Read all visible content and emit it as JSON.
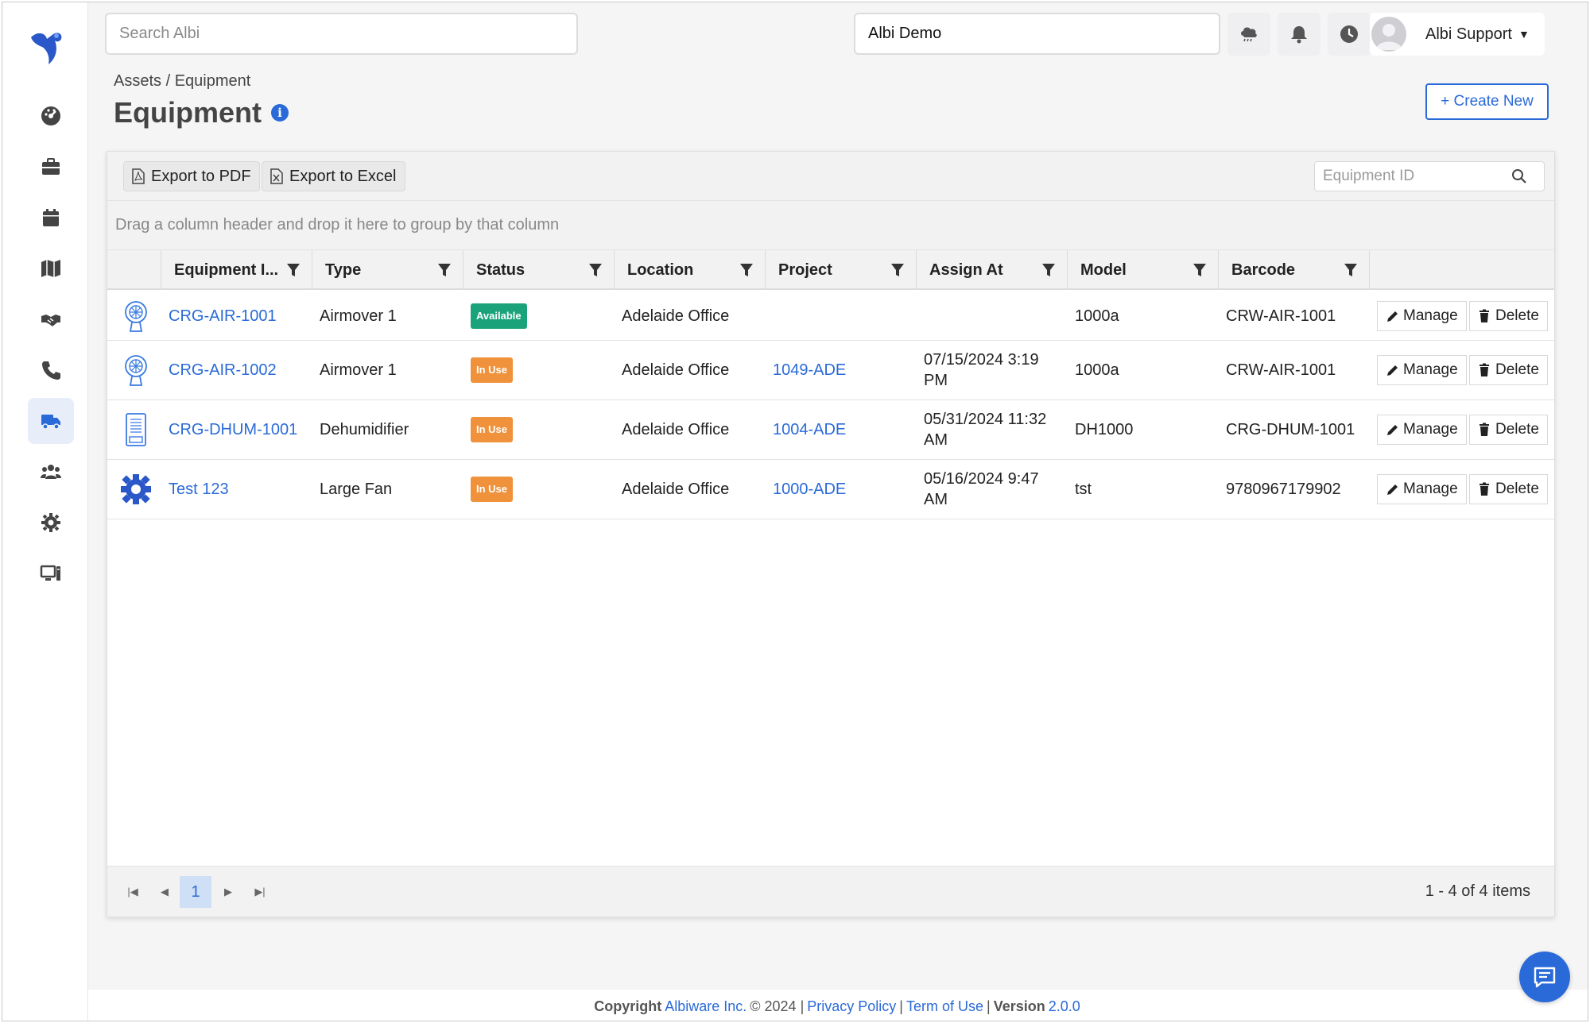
{
  "topbar": {
    "search_placeholder": "Search Albi",
    "tenant": "Albi Demo",
    "user_name": "Albi Support"
  },
  "header": {
    "breadcrumb": "Assets / Equipment",
    "title": "Equipment",
    "info_glyph": "i",
    "create_label": "+ Create New"
  },
  "toolbar": {
    "export_pdf": "Export to PDF",
    "export_excel": "Export to Excel",
    "id_search_placeholder": "Equipment ID",
    "group_hint": "Drag a column header and drop it here to group by that column"
  },
  "columns": {
    "equipment_id": "Equipment I...",
    "type": "Type",
    "status": "Status",
    "location": "Location",
    "project": "Project",
    "assign_at": "Assign At",
    "model": "Model",
    "barcode": "Barcode"
  },
  "actions": {
    "manage": "Manage",
    "delete": "Delete"
  },
  "rows": [
    {
      "icon": "airmover-icon",
      "id": "CRG-AIR-1001",
      "type": "Airmover 1",
      "status": "Available",
      "status_kind": "available",
      "location": "Adelaide Office",
      "project": "",
      "assign_at_1": "",
      "assign_at_2": "",
      "model": "1000a",
      "barcode": "CRW-AIR-1001"
    },
    {
      "icon": "airmover-icon",
      "id": "CRG-AIR-1002",
      "type": "Airmover 1",
      "status": "In Use",
      "status_kind": "inuse",
      "location": "Adelaide Office",
      "project": "1049-ADE",
      "assign_at_1": "07/15/2024 3:19",
      "assign_at_2": "PM",
      "model": "1000a",
      "barcode": "CRW-AIR-1001"
    },
    {
      "icon": "dehumidifier-icon",
      "id": "CRG-DHUM-1001",
      "type": "Dehumidifier",
      "status": "In Use",
      "status_kind": "inuse",
      "location": "Adelaide Office",
      "project": "1004-ADE",
      "assign_at_1": "05/31/2024 11:32",
      "assign_at_2": "AM",
      "model": "DH1000",
      "barcode": "CRG-DHUM-1001"
    },
    {
      "icon": "gear-icon",
      "id": "Test 123",
      "type": "Large Fan",
      "status": "In Use",
      "status_kind": "inuse",
      "location": "Adelaide Office",
      "project": "1000-ADE",
      "assign_at_1": "05/16/2024 9:47",
      "assign_at_2": "AM",
      "model": "tst",
      "barcode": "9780967179902"
    }
  ],
  "pager": {
    "current_page": "1",
    "summary": "1 - 4 of 4 items"
  },
  "footer": {
    "copyright_label": "Copyright",
    "company": "Albiware Inc.",
    "year_text": "© 2024 |",
    "privacy": "Privacy Policy",
    "sep": "|",
    "terms": "Term of Use",
    "sep2": "|",
    "version_label": "Version",
    "version": "2.0.0"
  },
  "colors": {
    "accent": "#2a6ad8",
    "available": "#1aa37a",
    "in_use": "#f0923b"
  }
}
